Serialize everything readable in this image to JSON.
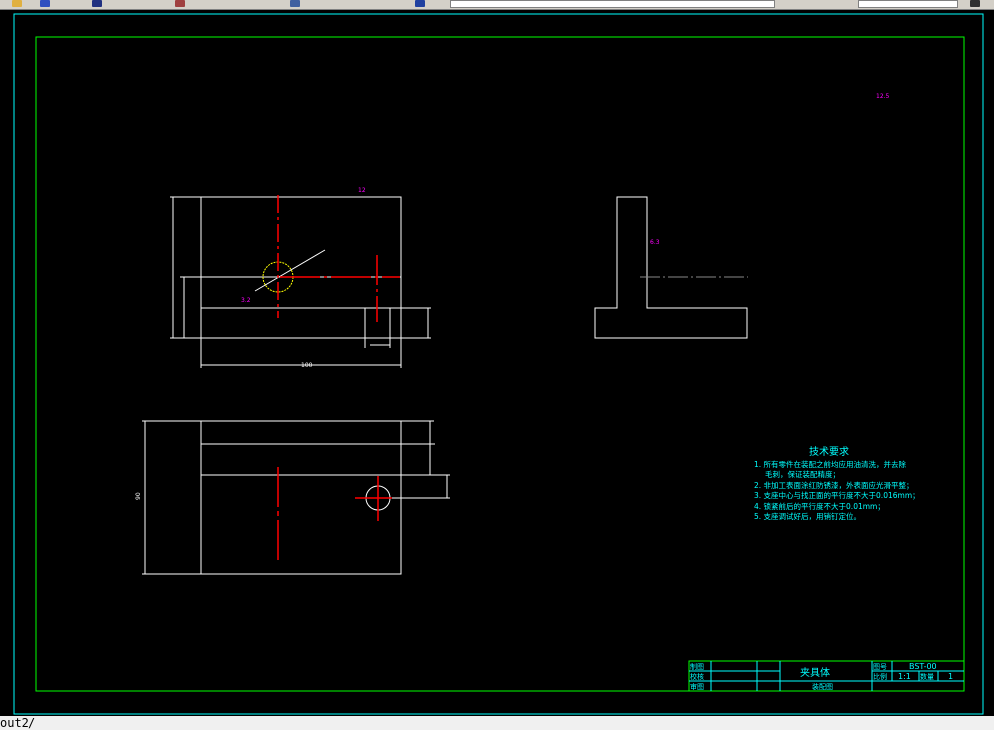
{
  "layout_tab": "out2",
  "drawing": {
    "dimensions": {
      "width_front": "100",
      "height_top": "90"
    },
    "roughness": {
      "top": "12",
      "hole": "3.2",
      "side": "6.3",
      "corner": "12.5"
    },
    "tech_requirements": {
      "title": "技术要求",
      "items": [
        "1. 所有零件在装配之前均应用油清洗，并去除",
        "毛刺，保证装配精度；",
        "2. 非加工表面涂红防锈漆，外表面应光滑平整；",
        "3. 支座中心与找正面的平行度不大于0.016mm；",
        "4. 锁紧前后的平行度不大于0.01mm；",
        "5. 支座调试好后，用销钉定位。"
      ]
    },
    "title_block": {
      "drawn_label": "制图",
      "checked_label": "校核",
      "reviewed_label": "审图",
      "part_name": "夹具体",
      "drawing_type": "装配图",
      "drawing_no_label": "图号",
      "drawing_no": "BST-00",
      "scale_label": "比例",
      "scale": "1:1",
      "quantity_label": "数量",
      "quantity": "1"
    }
  },
  "colors": {
    "frame": "#00ff00",
    "border": "#00ffff",
    "line": "#ffffff",
    "center": "#ff0000",
    "text": "#00ffff",
    "hole": "#ffff00",
    "rough": "#ff00ff"
  }
}
